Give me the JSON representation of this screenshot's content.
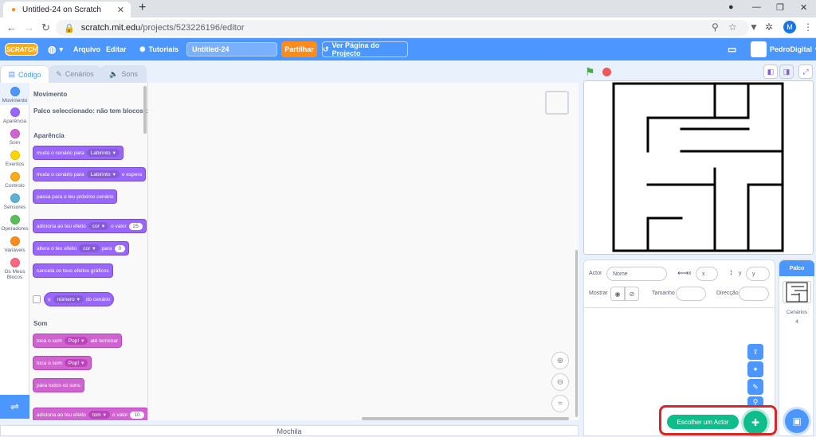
{
  "browser": {
    "tab_title": "Untitled-24 on Scratch",
    "url_host": "scratch.mit.edu",
    "url_path": "/projects/523226196/editor",
    "profile_initial": "M"
  },
  "menubar": {
    "logo": "SCRATCH",
    "language_label": "",
    "file": "Arquivo",
    "edit": "Editar",
    "tutorials": "Tutoriais",
    "project_title": "Untitled-24",
    "share": "Partilhar",
    "see_project": "Ver Página do Projecto",
    "username": "PedroDigital"
  },
  "editor_tabs": {
    "code": "Código",
    "costumes": "Cenários",
    "sounds": "Sons"
  },
  "categories": [
    {
      "label": "Movimento",
      "color": "#4c97ff"
    },
    {
      "label": "Aparência",
      "color": "#9966ff"
    },
    {
      "label": "Som",
      "color": "#cf63cf"
    },
    {
      "label": "Eventos",
      "color": "#ffd500"
    },
    {
      "label": "Controlo",
      "color": "#ffab19"
    },
    {
      "label": "Sensores",
      "color": "#5cb1d6"
    },
    {
      "label": "Operadores",
      "color": "#59c059"
    },
    {
      "label": "Variáveis",
      "color": "#ff8c1a"
    },
    {
      "label": "Os Meus Blocos",
      "color": "#ff6680"
    }
  ],
  "palette": {
    "motion_heading": "Movimento",
    "motion_note": "Palco seleccionado: não tem blocos de",
    "looks_heading": "Aparência",
    "b1_text": "muda o cenário para",
    "b1_dd": "Labirinto",
    "b2_text": "muda o cenário para",
    "b2_dd": "Labirinto",
    "b2_tail": "e espera",
    "b3_text": "passa para o teu próximo cenário",
    "b4_text": "adiciona ao teu efeito",
    "b4_dd": "cor",
    "b4_mid": "o valor",
    "b4_num": "25",
    "b5_text": "altera o teu efeito",
    "b5_dd": "cor",
    "b5_mid": "para",
    "b5_num": "0",
    "b6_text": "cancela os teus efeitos gráficos",
    "b7_pre": "o",
    "b7_dd": "número",
    "b7_tail": "do cenário",
    "sound_heading": "Som",
    "s1_text": "toca o som",
    "s1_dd": "Pop!",
    "s1_tail": "até terminar",
    "s2_text": "toca o som",
    "s2_dd": "Pop!",
    "s3_text": "pára todos os sons",
    "s4_text": "adiciona ao teu efeito",
    "s4_dd": "tom",
    "s4_mid": "o valor",
    "s4_num": "10"
  },
  "backpack": "Mochila",
  "sprite_info": {
    "sprite_label": "Actor",
    "sprite_placeholder": "Nome",
    "x_label": "x",
    "x_placeholder": "x",
    "y_label": "y",
    "y_placeholder": "y",
    "show_label": "Mostrar",
    "size_label": "Tamanho",
    "direction_label": "Direcção"
  },
  "stage_selector": {
    "title": "Palco",
    "backdrops_label": "Cenários",
    "backdrops_count": "4"
  },
  "choose_sprite": "Escolher um Actor"
}
